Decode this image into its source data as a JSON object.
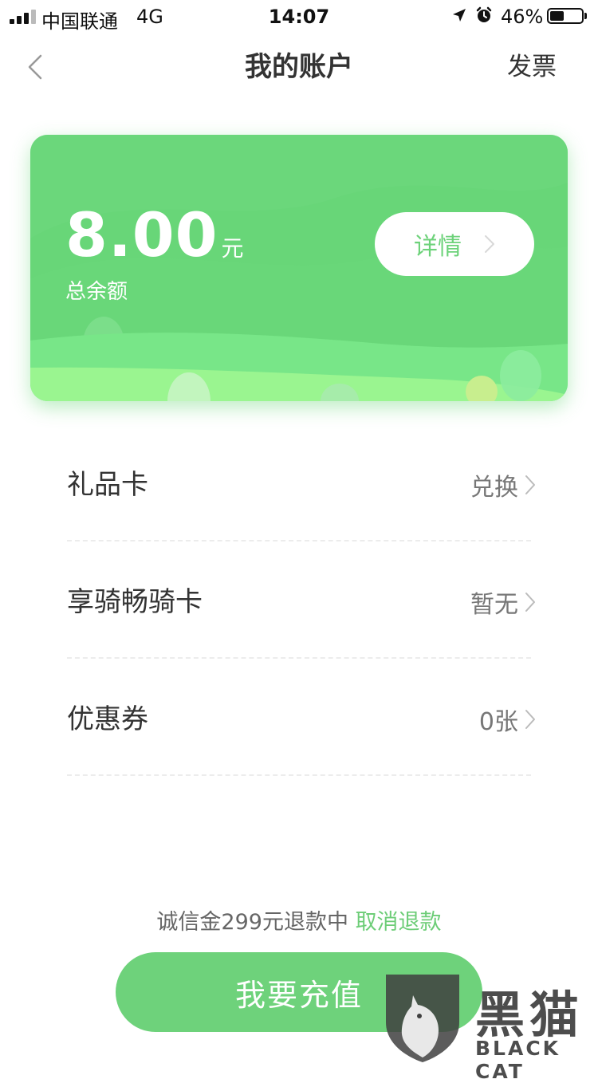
{
  "status_bar": {
    "carrier": "中国联通",
    "network": "4G",
    "time": "14:07",
    "battery_percent": "46%",
    "battery_level": 0.46,
    "signal_bars_active": 3,
    "signal_bars_total": 4
  },
  "nav": {
    "title": "我的账户",
    "right_label": "发票"
  },
  "card": {
    "amount": "8.00",
    "unit": "元",
    "label": "总余额",
    "details_label": "详情",
    "colors": {
      "card_green": "#6bd87a",
      "hill_green": "#8ef08c"
    }
  },
  "list": {
    "items": [
      {
        "title": "礼品卡",
        "value": "兑换"
      },
      {
        "title": "享骑畅骑卡",
        "value": "暂无"
      },
      {
        "title": "优惠券",
        "value": "0张"
      }
    ]
  },
  "deposit": {
    "note": "诚信金299元退款中",
    "cancel_label": "取消退款"
  },
  "recharge_label": "我要充值",
  "watermark": {
    "cn": "黑猫",
    "en": "BLACK CAT"
  },
  "colors": {
    "accent": "#6ed27b",
    "link": "#6dcd77"
  }
}
